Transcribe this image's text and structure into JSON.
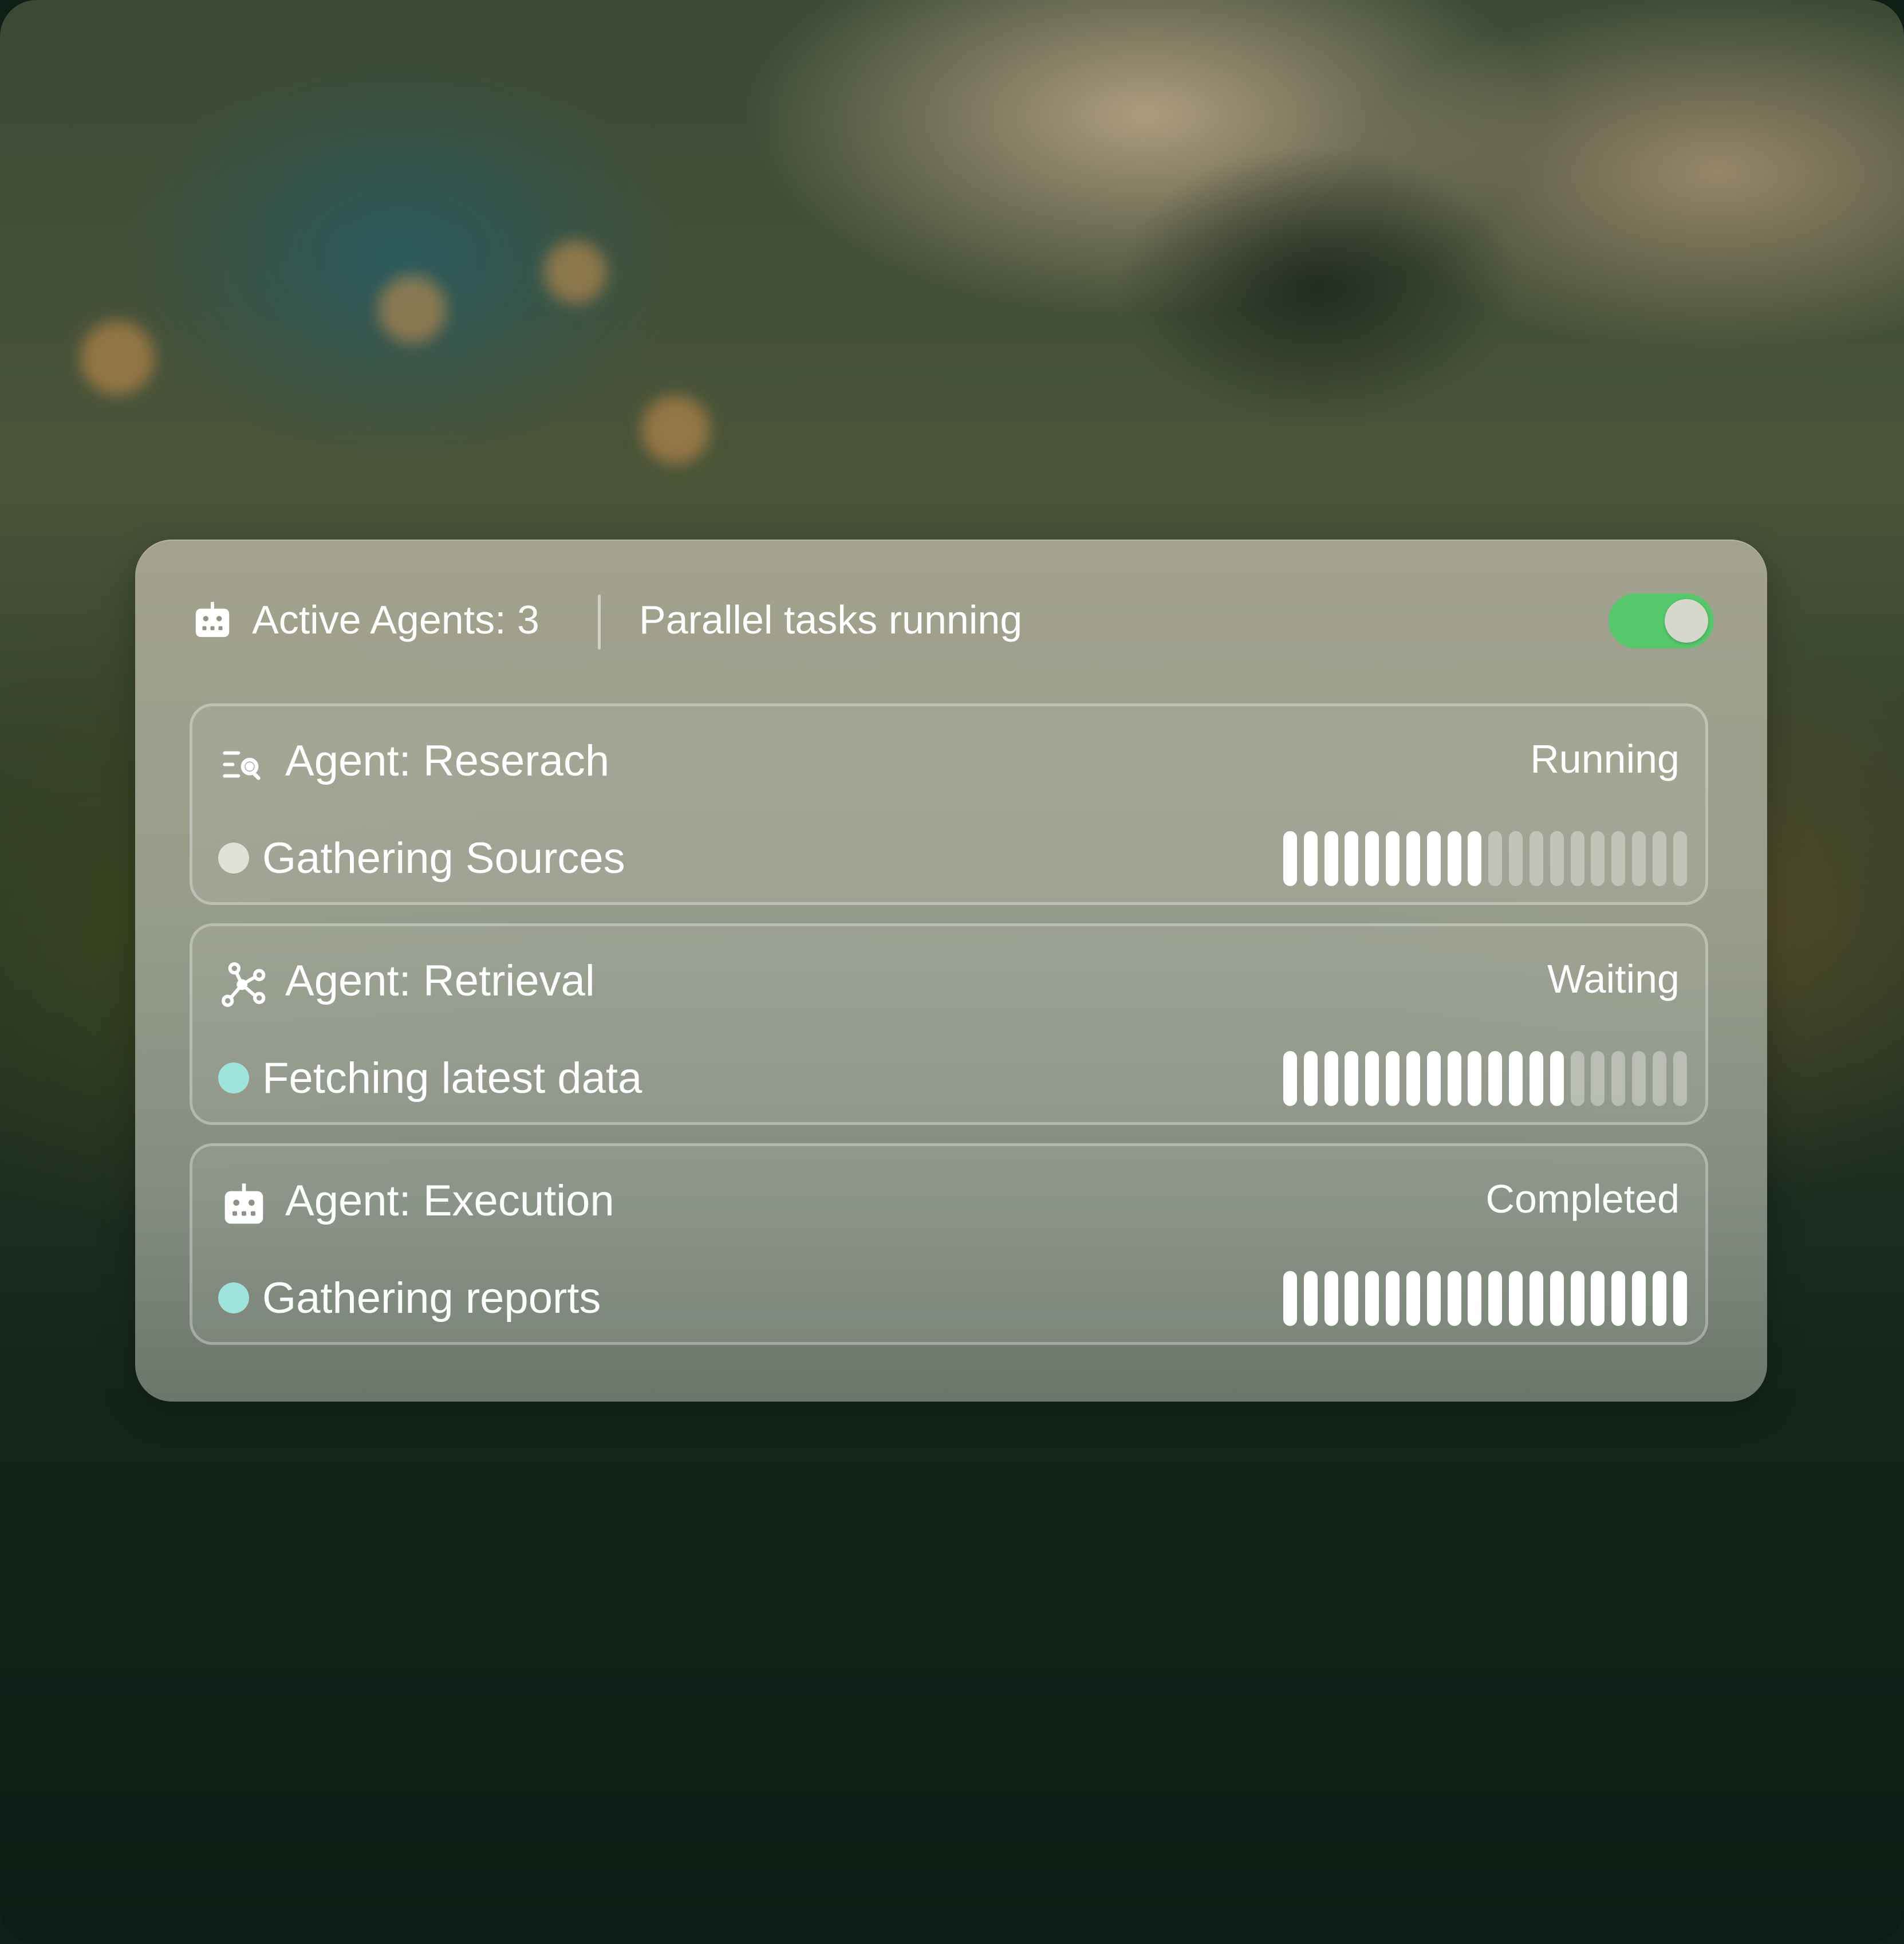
{
  "header": {
    "active_label": "Active Agents:",
    "active_count": "3",
    "status_text": "Parallel tasks running",
    "toggle_on": true
  },
  "colors": {
    "toggle_on": "#55c86c",
    "dot_idle": "#e0e2d6",
    "dot_active": "#9ee3dc"
  },
  "agents": [
    {
      "key": "Agent:",
      "name": "Reserach",
      "icon": "search-list-icon",
      "status": "Running",
      "task": "Gathering Sources",
      "dot_color": "#e0e2d6",
      "progress_segments_filled": 10,
      "progress_segments_total": 20
    },
    {
      "key": "Agent:",
      "name": "Retrieval",
      "icon": "network-nodes-icon",
      "status": "Waiting",
      "task": "Fetching latest data",
      "dot_color": "#9ee3dc",
      "progress_segments_filled": 14,
      "progress_segments_total": 20
    },
    {
      "key": "Agent:",
      "name": "Execution",
      "icon": "robot-icon",
      "status": "Completed",
      "task": "Gathering reports",
      "dot_color": "#9ee3dc",
      "progress_segments_filled": 20,
      "progress_segments_total": 20
    }
  ]
}
